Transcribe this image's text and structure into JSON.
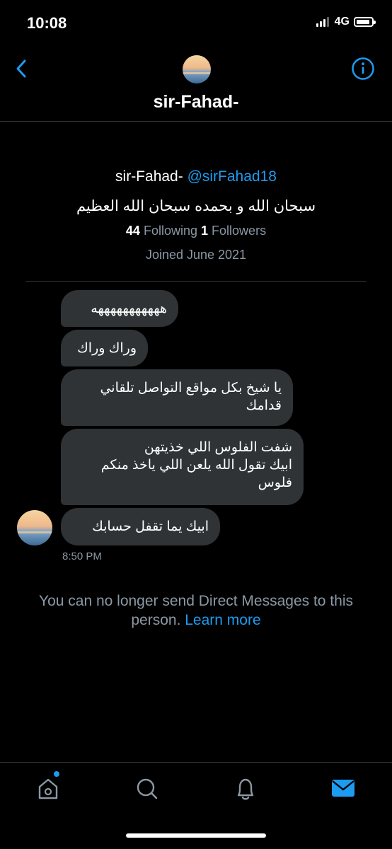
{
  "status_bar": {
    "time": "10:08",
    "network": "4G",
    "battery_level": 0.8
  },
  "header": {
    "name": "sir-Fahad-",
    "back_icon": "chevron-left-icon",
    "info_icon": "info-icon"
  },
  "profile": {
    "name": "sir-Fahad-",
    "handle": "@sirFahad18",
    "bio": "سبحان الله و بحمده سبحان الله العظيم",
    "following_count": "44",
    "following_label": "Following",
    "followers_count": "1",
    "followers_label": "Followers",
    "joined": "Joined June 2021"
  },
  "messages": [
    {
      "text": "هههههههههههه"
    },
    {
      "text": "وراك وراك"
    },
    {
      "text": "يا شيخ بكل مواقع التواصل تلقاني قدامك"
    },
    {
      "text": "شفت الفلوس اللي خذيتهن\nابيك تقول الله يلعن اللي ياخذ منكم فلوس"
    },
    {
      "text": "ابيك يما تقفل حسابك"
    }
  ],
  "message_time": "8:50 PM",
  "notice": {
    "text": "You can no longer send Direct Messages to this person.",
    "link": "Learn more"
  },
  "tabs": [
    {
      "icon": "home-icon",
      "has_badge": true
    },
    {
      "icon": "search-icon",
      "has_badge": false
    },
    {
      "icon": "bell-icon",
      "has_badge": false
    },
    {
      "icon": "mail-icon",
      "active": true
    }
  ],
  "colors": {
    "accent": "#1d9bf0",
    "bubble": "#2f3336",
    "muted": "#8b98a5",
    "background": "#000000"
  }
}
